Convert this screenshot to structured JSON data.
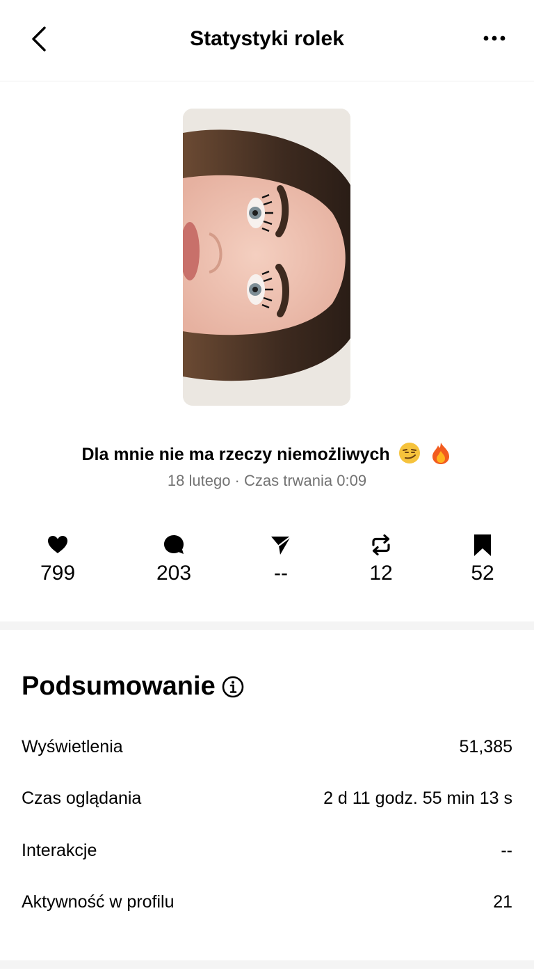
{
  "header": {
    "title": "Statystyki rolek",
    "back_icon": "chevron-left-icon",
    "more_icon": "more-horizontal-icon"
  },
  "reel": {
    "caption": "Dla mnie nie ma rzeczy niemożliwych",
    "caption_emojis": [
      "😏",
      "🔥"
    ],
    "meta": "18 lutego · Czas trwania 0:09"
  },
  "stats": [
    {
      "icon": "heart-icon",
      "value": "799"
    },
    {
      "icon": "comment-icon",
      "value": "203"
    },
    {
      "icon": "send-icon",
      "value": "--"
    },
    {
      "icon": "repost-icon",
      "value": "12"
    },
    {
      "icon": "bookmark-icon",
      "value": "52"
    }
  ],
  "summary": {
    "title": "Podsumowanie",
    "rows": [
      {
        "label": "Wyświetlenia",
        "value": "51,385"
      },
      {
        "label": "Czas oglądania",
        "value": "2 d 11 godz. 55 min 13 s"
      },
      {
        "label": "Interakcje",
        "value": "--"
      },
      {
        "label": "Aktywność w profilu",
        "value": "21"
      }
    ]
  }
}
